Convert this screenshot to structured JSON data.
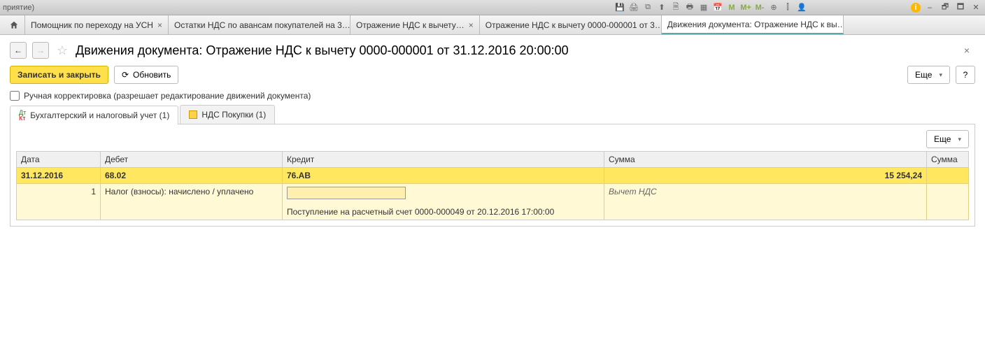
{
  "systembar": {
    "title_fragment": "приятие)",
    "icons": {
      "save": "💾",
      "print": "🖨",
      "copy": "⧉",
      "up": "⬆",
      "preview": "🗎",
      "printer2": "🖶",
      "calc": "▦",
      "cal": "📅",
      "m": "M",
      "mplus": "M+",
      "mminus": "M-",
      "zoomin": "⊕",
      "book": "⫿",
      "user": "👤",
      "info": "i",
      "min": "–",
      "rest": "🗗",
      "max": "🗖",
      "close": "✕"
    }
  },
  "tabs": [
    {
      "label": "Помощник по переходу на УСН"
    },
    {
      "label": "Остатки НДС по авансам покупателей на 3…"
    },
    {
      "label": "Отражение НДС к вычету…"
    },
    {
      "label": "Отражение НДС к вычету 0000-000001 от 3…"
    },
    {
      "label": "Движения документа: Отражение НДС к вы…",
      "active": true
    }
  ],
  "page": {
    "title": "Движения документа: Отражение НДС к вычету 0000-000001 от 31.12.2016 20:00:00"
  },
  "toolbar": {
    "save_close": "Записать и закрыть",
    "refresh": "Обновить",
    "more": "Еще",
    "help": "?"
  },
  "checkbox": {
    "label": "Ручная корректировка (разрешает редактирование движений документа)"
  },
  "intabs": [
    {
      "label": "Бухгалтерский и налоговый учет (1)",
      "active": true,
      "kind": "dtkt"
    },
    {
      "label": "НДС Покупки (1)",
      "active": false,
      "kind": "doc"
    }
  ],
  "table": {
    "more": "Еще",
    "headers": {
      "date": "Дата",
      "debit": "Дебет",
      "credit": "Кредит",
      "sum": "Сумма",
      "sum2": "Сумма"
    },
    "row1": {
      "date": "31.12.2016",
      "debit": "68.02",
      "credit": "76.АВ",
      "sum": "15 254,24"
    },
    "row2": {
      "num": "1",
      "debit_desc": "Налог (взносы): начислено / уплачено",
      "sum_desc": "Вычет НДС"
    },
    "row3": {
      "credit_desc": "Поступление на расчетный счет 0000-000049 от 20.12.2016 17:00:00"
    }
  }
}
